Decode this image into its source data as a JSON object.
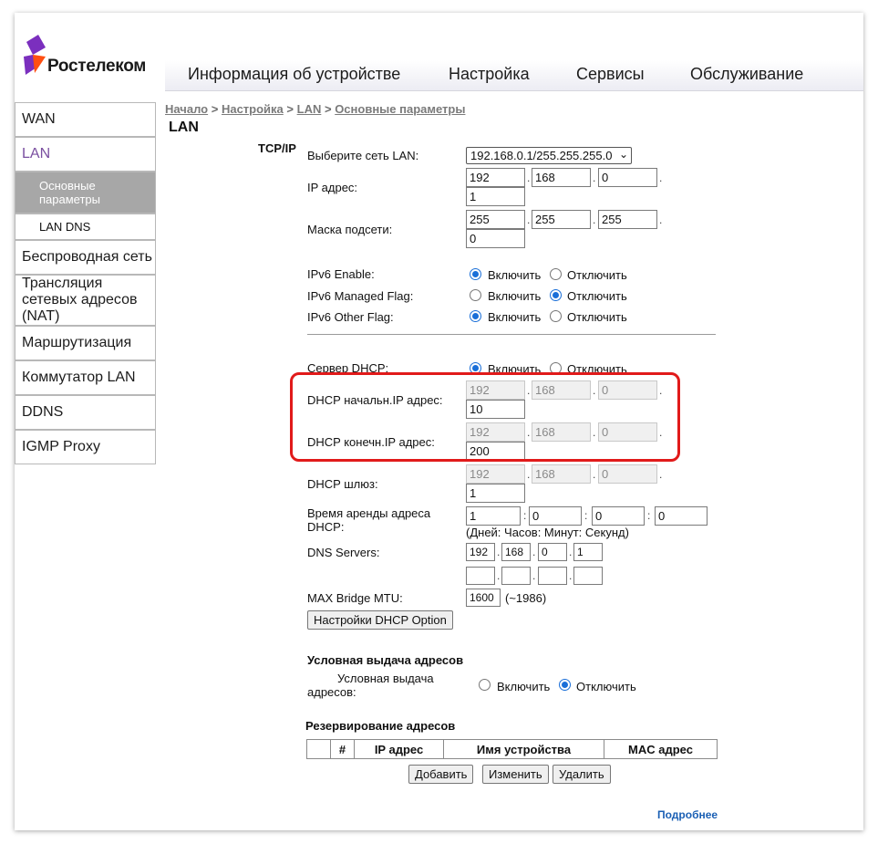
{
  "brand": {
    "name": "Ростелеком",
    "colors": {
      "purple": "#7b2fbe",
      "orange": "#ff4f12",
      "highlight": "#e11a1a"
    }
  },
  "topnav": {
    "items": [
      "Информация об устройстве",
      "Настройка",
      "Сервисы",
      "Обслуживание"
    ]
  },
  "sidebar": {
    "items": [
      "WAN",
      "LAN",
      "Основные параметры",
      "LAN DNS",
      "Беспроводная сеть",
      "Трансляция сетевых адресов (NAT)",
      "Маршрутизация",
      "Коммутатор LAN",
      "DDNS",
      "IGMP Proxy"
    ]
  },
  "breadcrumb": {
    "items": [
      "Начало",
      "Настройка",
      "LAN",
      "Основные параметры"
    ],
    "separator": ">"
  },
  "page": {
    "title": "LAN"
  },
  "tcpip": {
    "section_label": "TCP/IP",
    "lan_select_label": "Выберите сеть LAN:",
    "lan_select_value": "192.168.0.1/255.255.255.0",
    "ip_label": "IP адрес:",
    "ip": [
      "192",
      "168",
      "0",
      "1"
    ],
    "mask_label": "Маска подсети:",
    "mask": [
      "255",
      "255",
      "255",
      "0"
    ],
    "ipv6_enable_label": "IPv6 Enable:",
    "ipv6_managed_label": "IPv6 Managed Flag:",
    "ipv6_other_label": "IPv6 Other Flag:",
    "on_label": "Включить",
    "off_label": "Отключить",
    "ipv6_enable": "on",
    "ipv6_managed": "off",
    "ipv6_other": "on"
  },
  "dhcp": {
    "server_label": "Сервер DHCP:",
    "server": "on",
    "start_label": "DHCP начальн.IP адрес:",
    "start": [
      "192",
      "168",
      "0",
      "10"
    ],
    "end_label": "DHCP конечн.IP адрес:",
    "end": [
      "192",
      "168",
      "0",
      "200"
    ],
    "gateway_label": "DHCP шлюз:",
    "gateway": [
      "192",
      "168",
      "0",
      "1"
    ],
    "lease_label": "Время аренды адреса DHCP:",
    "lease": [
      "1",
      "0",
      "0",
      "0"
    ],
    "lease_hint": "(Дней: Часов: Минут: Секунд)",
    "dns_label": "DNS Servers:",
    "dns1": [
      "192",
      "168",
      "0",
      "1"
    ],
    "dns2": [
      "",
      "",
      "",
      ""
    ],
    "mtu_label": "MAX Bridge MTU:",
    "mtu": "1600",
    "mtu_hint": "(~1986)",
    "option_button": "Настройки DHCP Option"
  },
  "conditional": {
    "title": "Условная выдача адресов",
    "label_line1": "Условная выдача",
    "label_line2": "адресов:",
    "on_label": "Включить",
    "off_label": "Отключить",
    "value": "off"
  },
  "reservation": {
    "title": "Резервирование адресов",
    "columns": [
      "",
      "#",
      "IP адрес",
      "Имя устройства",
      "MAC адрес"
    ],
    "add_button": "Добавить",
    "edit_button": "Изменить",
    "delete_button": "Удалить"
  },
  "footer": {
    "more_link": "Подробнее"
  }
}
